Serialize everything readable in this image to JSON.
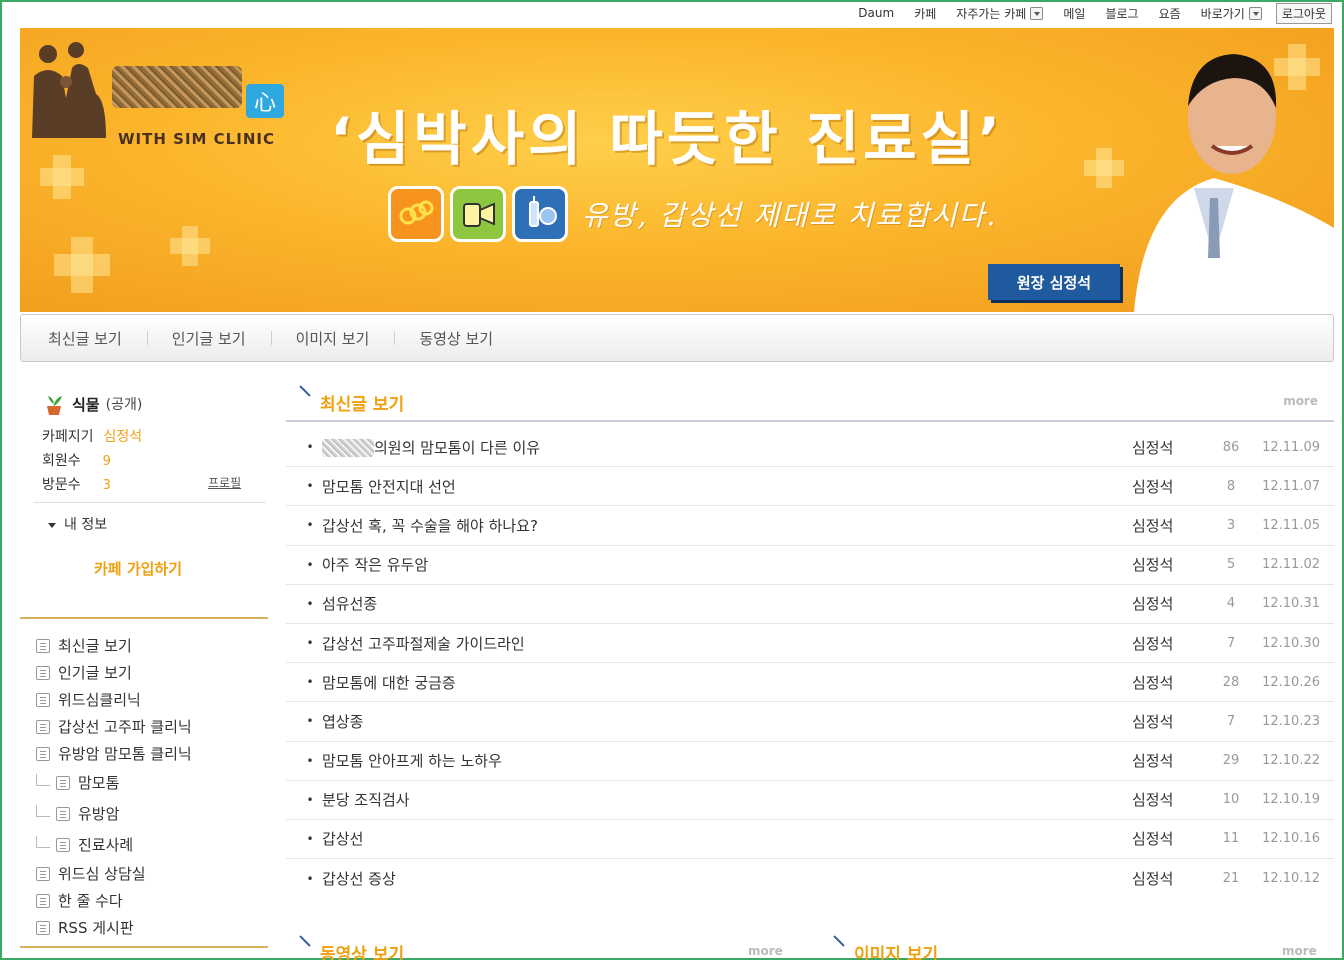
{
  "gnb": {
    "items": [
      "Daum",
      "카페",
      "자주가는 카페",
      "메일",
      "블로그",
      "요즘",
      "바로가기"
    ],
    "logout": "로그아웃"
  },
  "banner": {
    "brand": "WITH SIM CLINIC",
    "heart": "心",
    "headline": "‘심박사의 따듯한 진료실’",
    "tagline": "유방, 갑상선 제대로 치료합시다.",
    "doctor_badge": "원장 심정석",
    "colors": {
      "bg": "#fbb52c",
      "badge": "#1f5a9e",
      "icon1": "#f7941d",
      "icon2": "#8dc63f",
      "icon3": "#2e6fb7"
    }
  },
  "tabs": [
    "최신글 보기",
    "인기글 보기",
    "이미지 보기",
    "동영상 보기"
  ],
  "sidebar": {
    "cafe_category": "식물",
    "cafe_visibility": "(공개)",
    "manager_label": "카페지기",
    "manager_value": "심정석",
    "members_label": "회원수",
    "members_value": "9",
    "visits_label": "방문수",
    "visits_value": "3",
    "profile_link": "프로필",
    "my_info": "내 정보",
    "join": "카페 가입하기",
    "menu": [
      {
        "label": "최신글 보기",
        "icon": "new-icon",
        "sub": false
      },
      {
        "label": "인기글 보기",
        "icon": "star-icon",
        "sub": false
      },
      {
        "label": "위드심클리닉",
        "icon": "board-icon",
        "sub": false
      },
      {
        "label": "갑상선 고주파 클리닉",
        "icon": "board-icon",
        "sub": false
      },
      {
        "label": "유방암 맘모톰 클리닉",
        "icon": "board-icon",
        "sub": false
      },
      {
        "label": "맘모톰",
        "icon": "board-icon",
        "sub": true
      },
      {
        "label": "유방암",
        "icon": "board-icon",
        "sub": true
      },
      {
        "label": "진료사례",
        "icon": "board-icon",
        "sub": true
      },
      {
        "label": "위드심 상담실",
        "icon": "qa-icon",
        "sub": false
      },
      {
        "label": "한 줄 수다",
        "icon": "pencil-icon",
        "sub": false
      },
      {
        "label": "RSS 게시판",
        "icon": "rss-icon",
        "sub": false
      }
    ]
  },
  "latest": {
    "title": "최신글 보기",
    "more": "more",
    "posts": [
      {
        "title": "의원의 맘모톰이 다른 이유",
        "blurred_prefix": true,
        "author": "심정석",
        "count": "86",
        "date": "12.11.09"
      },
      {
        "title": "맘모톰 안전지대 선언",
        "blurred_prefix": false,
        "author": "심정석",
        "count": "8",
        "date": "12.11.07"
      },
      {
        "title": "갑상선 혹, 꼭 수술을 해야 하나요?",
        "blurred_prefix": false,
        "author": "심정석",
        "count": "3",
        "date": "12.11.05"
      },
      {
        "title": "아주 작은 유두암",
        "blurred_prefix": false,
        "author": "심정석",
        "count": "5",
        "date": "12.11.02"
      },
      {
        "title": "섬유선종",
        "blurred_prefix": false,
        "author": "심정석",
        "count": "4",
        "date": "12.10.31"
      },
      {
        "title": "갑상선 고주파절제술 가이드라인",
        "blurred_prefix": false,
        "author": "심정석",
        "count": "7",
        "date": "12.10.30"
      },
      {
        "title": "맘모톰에 대한 궁금증",
        "blurred_prefix": false,
        "author": "심정석",
        "count": "28",
        "date": "12.10.26"
      },
      {
        "title": "엽상종",
        "blurred_prefix": false,
        "author": "심정석",
        "count": "7",
        "date": "12.10.23"
      },
      {
        "title": " 맘모톰 안아프게 하는 노하우",
        "blurred_prefix": false,
        "author": "심정석",
        "count": "29",
        "date": "12.10.22"
      },
      {
        "title": "분당 조직검사",
        "blurred_prefix": false,
        "author": "심정석",
        "count": "10",
        "date": "12.10.19"
      },
      {
        "title": "갑상선",
        "blurred_prefix": false,
        "author": "심정석",
        "count": "11",
        "date": "12.10.16"
      },
      {
        "title": "갑상선 증상",
        "blurred_prefix": false,
        "author": "심정석",
        "count": "21",
        "date": "12.10.12"
      }
    ]
  },
  "video": {
    "title": "동영상 보기",
    "more": "more"
  },
  "image": {
    "title": "이미지 보기",
    "more": "more"
  }
}
